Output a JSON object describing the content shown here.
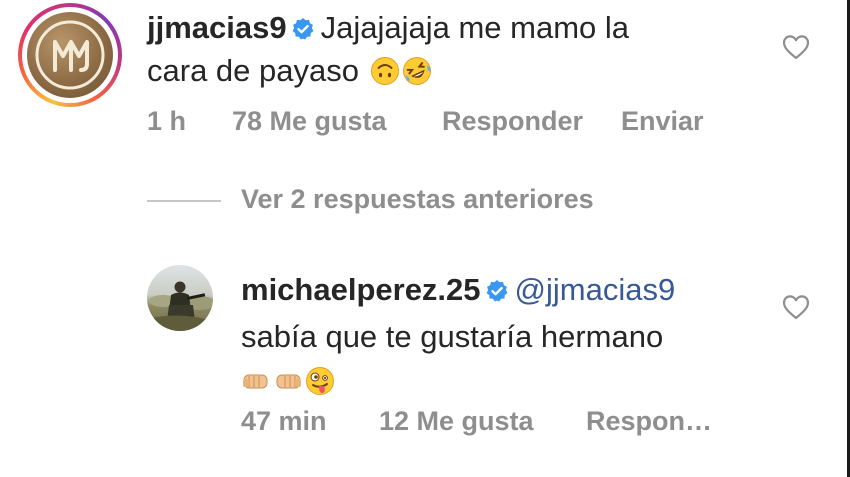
{
  "comment1": {
    "username": "jjmacias9",
    "text_line1": "Jajajajaja me mamo la",
    "text_line2": "cara de payaso",
    "time": "1 h",
    "likes": "78 Me gusta",
    "reply": "Responder",
    "send": "Enviar",
    "emojis": [
      "upside-down-face-emoji",
      "rolling-laughing-emoji"
    ]
  },
  "view_replies": "Ver 2 respuestas anteriores",
  "comment2": {
    "username": "michaelperez.25",
    "mention": "@jjmacias9",
    "text": "sabía que te gustaría hermano",
    "time": "47 min",
    "likes": "12 Me gusta",
    "reply": "Respon…",
    "emojis": [
      "left-fist-emoji",
      "right-fist-emoji",
      "zany-face-emoji"
    ]
  },
  "colors": {
    "text": "#262626",
    "meta": "#8e8e8e",
    "verified": "#3897f0",
    "mention": "#385898"
  }
}
